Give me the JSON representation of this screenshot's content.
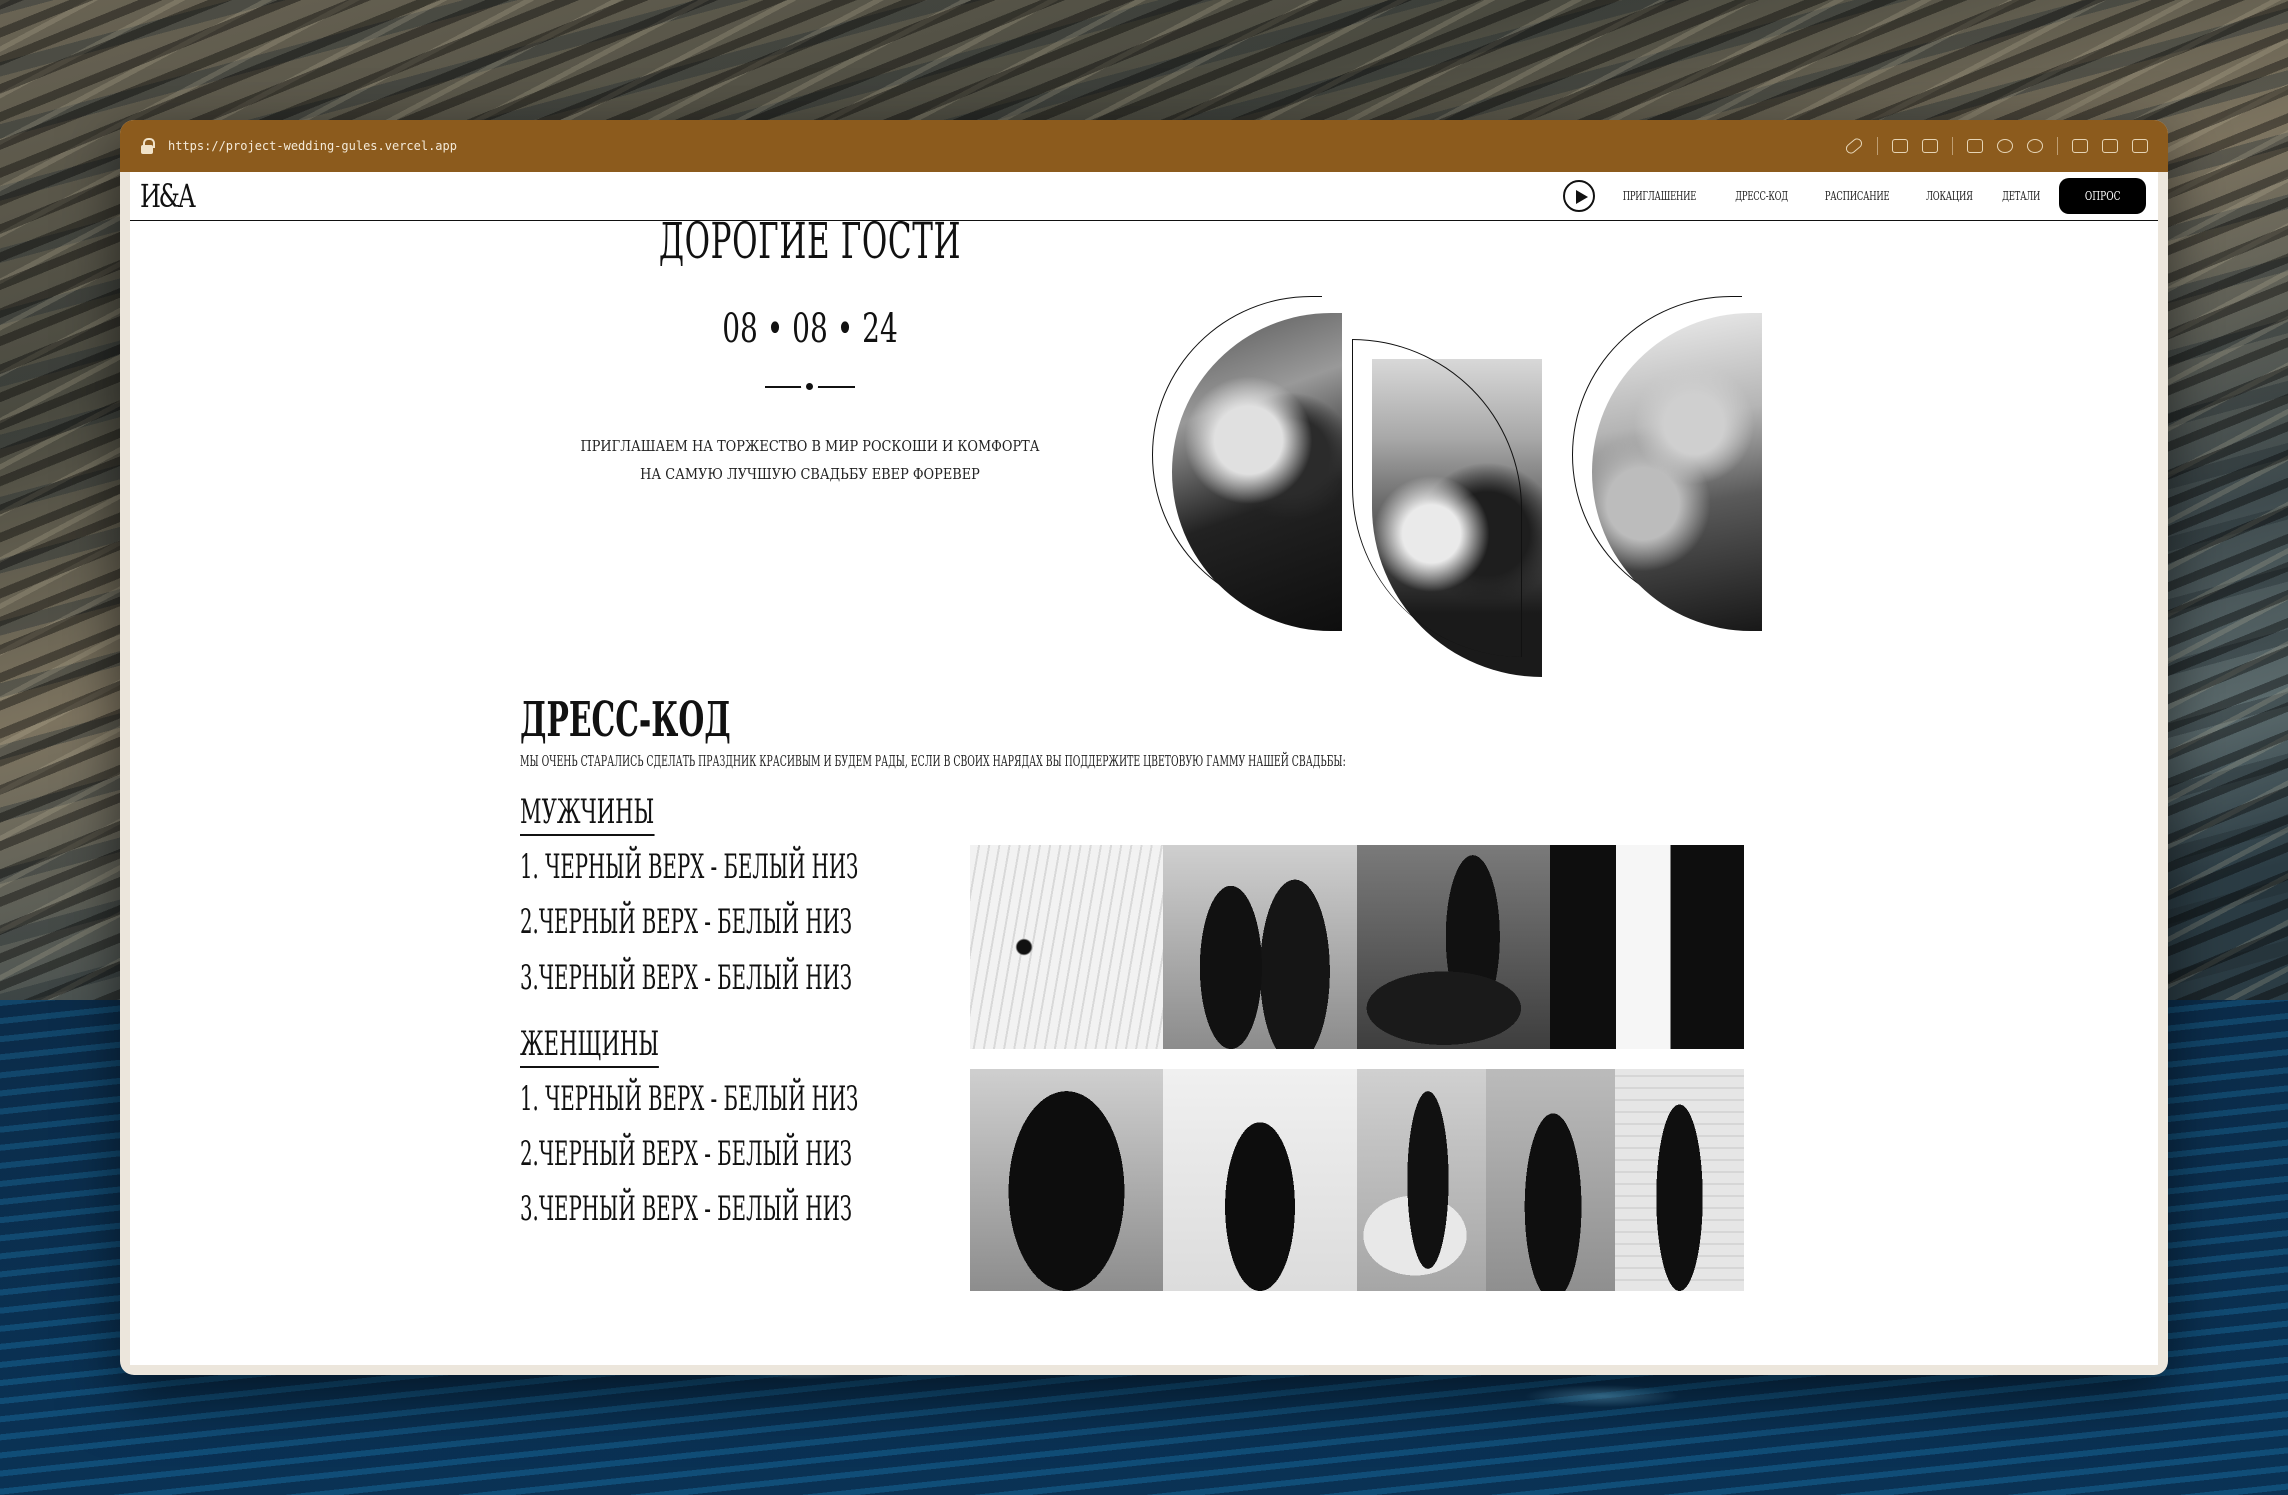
{
  "browser": {
    "url": "https://project-wedding-gules.vercel.app"
  },
  "nav": {
    "logo": "И&А",
    "links": [
      "ПРИГЛАШЕНИЕ",
      "ДРЕСС-КОД",
      "РАСПИСАНИЕ",
      "ЛОКАЦИЯ",
      "ДЕТАЛИ"
    ],
    "cta": "ОПРОС"
  },
  "hero": {
    "title": "ДОРОГИЕ ГОСТИ",
    "date": "08 • 08 • 24",
    "subtitle": "ПРИГЛАШАЕМ НА ТОРЖЕСТВО В МИР РОСКОШИ И КОМФОРТА НА САМУЮ ЛУЧШУЮ СВАДЬБУ ЕВЕР ФОРЕВЕР"
  },
  "dresscode": {
    "title": "ДРЕСС-КОД",
    "description": "МЫ ОЧЕНЬ СТАРАЛИСЬ СДЕЛАТЬ ПРАЗДНИК КРАСИВЫМ И БУДЕМ РАДЫ, ЕСЛИ В СВОИХ НАРЯДАХ ВЫ ПОДДЕРЖИТЕ ЦВЕТОВУЮ ГАММУ НАШЕЙ СВАДЬБЫ:",
    "men": {
      "title": "МУЖЧИНЫ",
      "items": [
        "1. ЧЕРНЫЙ ВЕРХ - БЕЛЫЙ НИЗ",
        "2.ЧЕРНЫЙ ВЕРХ - БЕЛЫЙ НИЗ",
        "3.ЧЕРНЫЙ ВЕРХ - БЕЛЫЙ НИЗ"
      ]
    },
    "women": {
      "title": "ЖЕНЩИНЫ",
      "items": [
        "1. ЧЕРНЫЙ ВЕРХ - БЕЛЫЙ НИЗ",
        "2.ЧЕРНЫЙ ВЕРХ - БЕЛЫЙ НИЗ",
        "3.ЧЕРНЫЙ ВЕРХ - БЕЛЫЙ НИЗ"
      ]
    }
  },
  "colors": {
    "urlbar": "#8c5b1d",
    "text": "#111111",
    "background": "#ffffff",
    "button": "#000000"
  }
}
